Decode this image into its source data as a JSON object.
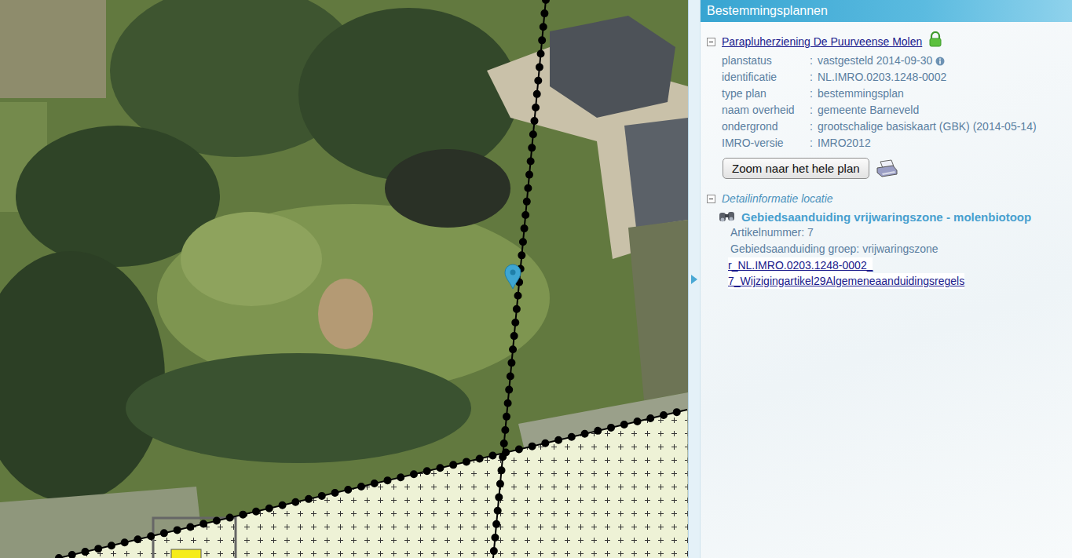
{
  "panel": {
    "title": "Bestemmingsplannen"
  },
  "plan": {
    "name": "Parapluherziening De Puurveense Molen",
    "expanded": true,
    "locked": true,
    "separator": ":",
    "fields": [
      {
        "label": "planstatus",
        "value": "vastgesteld 2014-09-30",
        "info": true
      },
      {
        "label": "identificatie",
        "value": "NL.IMRO.0203.1248-0002",
        "info": false
      },
      {
        "label": "type plan",
        "value": "bestemmingsplan",
        "info": false
      },
      {
        "label": "naam overheid",
        "value": "gemeente Barneveld",
        "info": false
      },
      {
        "label": "ondergrond",
        "value": "grootschalige basiskaart (GBK) (2014-05-14)",
        "info": false
      },
      {
        "label": "IMRO-versie",
        "value": "IMRO2012",
        "info": false
      }
    ],
    "zoom_button": "Zoom naar het hele plan"
  },
  "detail": {
    "title": "Detailinformatie locatie",
    "expanded": true,
    "item": {
      "title": "Gebiedsaanduiding vrijwaringszone - molenbiotoop",
      "lines": [
        "Artikelnummer: 7",
        "Gebiedsaanduiding groep: vrijwaringszone"
      ],
      "links": [
        "r_NL.IMRO.0203.1248-0002_",
        "7_Wijzigingartikel29Algemeneaanduidingsregels"
      ]
    }
  }
}
